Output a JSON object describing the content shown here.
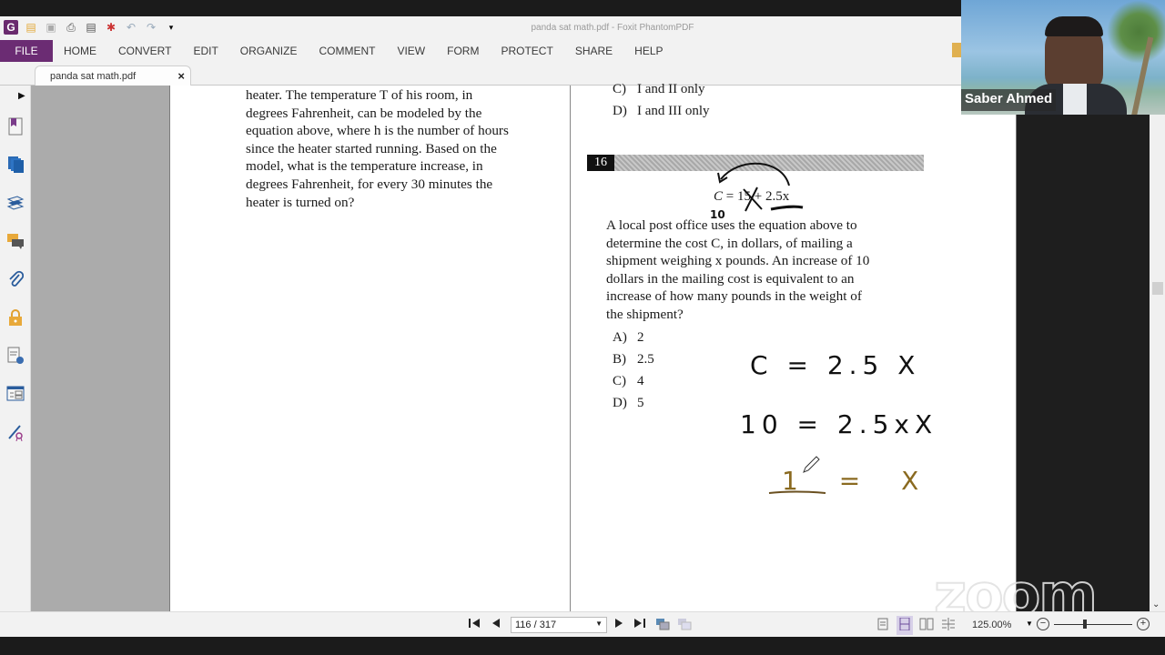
{
  "window": {
    "title": "panda sat math.pdf - Foxit PhantomPDF"
  },
  "quick_access": [
    {
      "name": "app-logo-icon",
      "glyph": "G"
    },
    {
      "name": "open-folder-icon",
      "glyph": "📂"
    },
    {
      "name": "save-icon",
      "glyph": "💾"
    },
    {
      "name": "print-icon",
      "glyph": "🖶"
    },
    {
      "name": "scan-icon",
      "glyph": "▤"
    },
    {
      "name": "new-icon",
      "glyph": "✱"
    },
    {
      "name": "undo-icon",
      "glyph": "↶"
    },
    {
      "name": "redo-icon",
      "glyph": "↷"
    },
    {
      "name": "customize-icon",
      "glyph": "▾"
    }
  ],
  "ribbon": {
    "tabs": [
      "FILE",
      "HOME",
      "CONVERT",
      "EDIT",
      "ORGANIZE",
      "COMMENT",
      "VIEW",
      "FORM",
      "PROTECT",
      "SHARE",
      "HELP"
    ]
  },
  "doc_tab": {
    "label": "panda sat math.pdf",
    "close": "×"
  },
  "left_nav": {
    "toggle": "▶",
    "icons": [
      "bookmark-icon",
      "pages-icon",
      "layers-icon",
      "comments-icon",
      "attachments-icon",
      "security-icon",
      "signature-icon",
      "fields-icon",
      "certify-icon"
    ]
  },
  "page_left": {
    "lines": [
      "heater. The temperature T of his room, in",
      "degrees Fahrenheit, can be modeled by the",
      "equation above, where h is the number of hours",
      "since the heater started running. Based on the",
      "model, what is the temperature increase, in",
      "degrees Fahrenheit, for every 30 minutes the",
      "heater is turned on?"
    ]
  },
  "page_right": {
    "prev_choices": [
      {
        "letter": "C)",
        "text": "I and II only"
      },
      {
        "letter": "D)",
        "text": "I and III only"
      }
    ],
    "question_number": "16",
    "equation": {
      "lhs": "C",
      "eq": "=",
      "const": "15",
      "rest": "+ 2.5x"
    },
    "question_lines": [
      "A local post office uses the equation above to",
      "determine the cost C, in dollars, of mailing a",
      "shipment weighing x pounds. An increase of 10",
      "dollars in the mailing cost is equivalent to an",
      "increase of how many pounds in the weight of",
      "the shipment?"
    ],
    "choices": [
      {
        "letter": "A)",
        "text": "2"
      },
      {
        "letter": "B)",
        "text": "2.5"
      },
      {
        "letter": "C)",
        "text": "4"
      },
      {
        "letter": "D)",
        "text": "5"
      }
    ],
    "handwriting": {
      "note_under_const": "10",
      "line1": "C = 2.5 X",
      "line2": "10 = 2.5xX",
      "line3": "1 = X",
      "ink_black": "#111111",
      "ink_gold": "#8a6a20"
    }
  },
  "status_bar": {
    "first_page": "⏮",
    "prev_page": "◀",
    "page_value": "116 / 317",
    "next_page": "▶",
    "last_page": "⏭",
    "zoom_value": "125.00%",
    "zoom_level_percent": 125
  },
  "webcam": {
    "name": "Saber Ahmed"
  },
  "watermark": "zoom",
  "colors": {
    "file_tab": "#6b2c73",
    "canvas_bg": "#ababab"
  }
}
